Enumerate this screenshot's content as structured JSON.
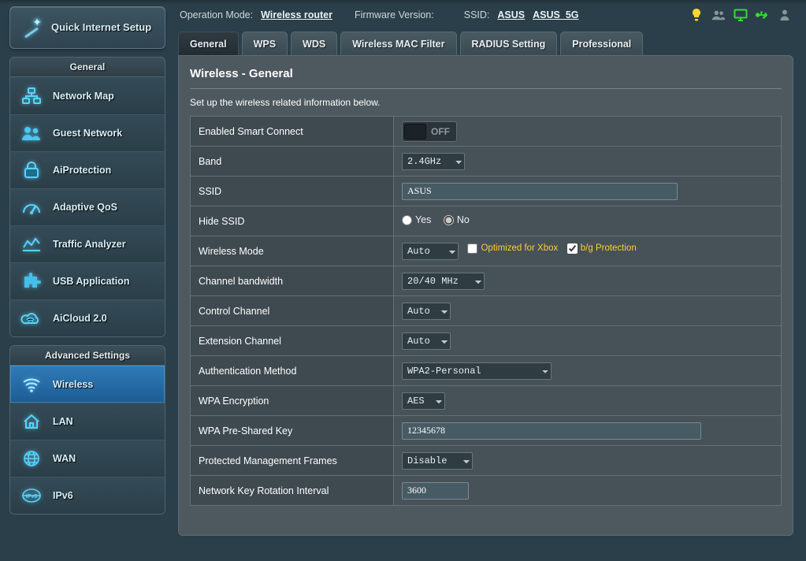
{
  "qis_label": "Quick Internet Setup",
  "topbar": {
    "op_mode_label": "Operation Mode:",
    "op_mode_value": "Wireless router",
    "fw_label": "Firmware Version:",
    "ssid_label": "SSID:",
    "ssid1": "ASUS",
    "ssid2": "ASUS_5G"
  },
  "sections": {
    "general_header": "General",
    "advanced_header": "Advanced Settings"
  },
  "general_menu": [
    {
      "label": "Network Map",
      "icon": "network-map-icon"
    },
    {
      "label": "Guest Network",
      "icon": "guest-network-icon"
    },
    {
      "label": "AiProtection",
      "icon": "lock-icon"
    },
    {
      "label": "Adaptive QoS",
      "icon": "gauge-icon"
    },
    {
      "label": "Traffic Analyzer",
      "icon": "chart-icon"
    },
    {
      "label": "USB Application",
      "icon": "puzzle-icon"
    },
    {
      "label": "AiCloud 2.0",
      "icon": "cloud-icon"
    }
  ],
  "advanced_menu": [
    {
      "label": "Wireless",
      "icon": "wifi-icon",
      "active": true
    },
    {
      "label": "LAN",
      "icon": "house-icon"
    },
    {
      "label": "WAN",
      "icon": "globe-icon"
    },
    {
      "label": "IPv6",
      "icon": "ipv6-icon"
    }
  ],
  "tabs": [
    "General",
    "WPS",
    "WDS",
    "Wireless MAC Filter",
    "RADIUS Setting",
    "Professional"
  ],
  "active_tab": 0,
  "panel": {
    "title": "Wireless - General",
    "description": "Set up the wireless related information below."
  },
  "fields": {
    "smart_connect": {
      "label": "Enabled Smart Connect",
      "state": "OFF"
    },
    "band": {
      "label": "Band",
      "value": "2.4GHz"
    },
    "ssid": {
      "label": "SSID",
      "value": "ASUS"
    },
    "hide_ssid": {
      "label": "Hide SSID",
      "yes": "Yes",
      "no": "No",
      "selected": "no"
    },
    "wmode": {
      "label": "Wireless Mode",
      "value": "Auto",
      "opt_xbox": "Optimized for Xbox",
      "bg": "b/g Protection"
    },
    "bw": {
      "label": "Channel bandwidth",
      "value": "20/40 MHz"
    },
    "cchan": {
      "label": "Control Channel",
      "value": "Auto"
    },
    "echan": {
      "label": "Extension Channel",
      "value": "Auto"
    },
    "auth": {
      "label": "Authentication Method",
      "value": "WPA2-Personal"
    },
    "enc": {
      "label": "WPA Encryption",
      "value": "AES"
    },
    "psk": {
      "label": "WPA Pre-Shared Key",
      "value": "12345678"
    },
    "pmf": {
      "label": "Protected Management Frames",
      "value": "Disable"
    },
    "rekey": {
      "label": "Network Key Rotation Interval",
      "value": "3600"
    }
  }
}
